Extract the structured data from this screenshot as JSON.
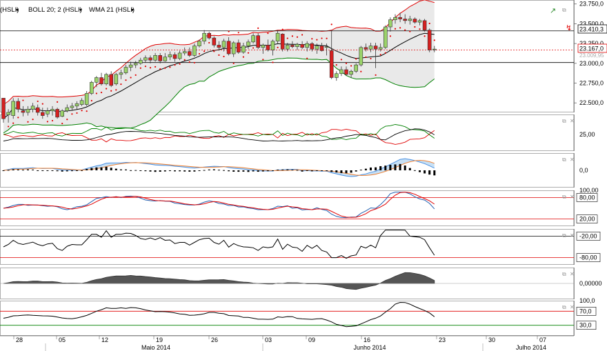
{
  "toolbar": {
    "items": [
      {
        "label": "(HSLI)",
        "menu": true
      },
      {
        "label": "BOLL 20; 2 (HSLI)",
        "menu": true
      },
      {
        "label": "WMA 21 (HSLI)",
        "menu": true
      }
    ]
  },
  "price_badges": {
    "current": "23.410,3",
    "last": "23.167,0",
    "other": "23.009,95"
  },
  "panel_icons": [
    "maximize-icon",
    "close-icon"
  ],
  "chart_data": [
    {
      "type": "candlestick",
      "panel": "price",
      "y_ticks": [
        {
          "value": 23750,
          "label": "23.750,0"
        },
        {
          "value": 23500,
          "label": "23.500,0"
        },
        {
          "value": 23250,
          "label": "23.250,0"
        },
        {
          "value": 23000,
          "label": "23.000,0"
        },
        {
          "value": 22750,
          "label": "22.750,0"
        },
        {
          "value": 22500,
          "label": "22.500,0"
        }
      ],
      "ylim": [
        22380,
        23800
      ],
      "hlines": [
        {
          "value": 23410,
          "color": "#000000"
        },
        {
          "value": 23167,
          "color": "#e00000"
        },
        {
          "value": 23010,
          "color": "#000000"
        }
      ],
      "overlays": [
        "bollinger-upper",
        "bollinger-lower",
        "wma-21",
        "parabolic-sar"
      ],
      "candles": [
        [
          22560,
          22560,
          22250,
          22300
        ],
        [
          22350,
          22420,
          22250,
          22380
        ],
        [
          22340,
          22560,
          22300,
          22520
        ],
        [
          22520,
          22560,
          22380,
          22420
        ],
        [
          22400,
          22460,
          22330,
          22380
        ],
        [
          22380,
          22460,
          22340,
          22420
        ],
        [
          22420,
          22500,
          22380,
          22460
        ],
        [
          22440,
          22480,
          22340,
          22380
        ],
        [
          22380,
          22440,
          22300,
          22340
        ],
        [
          22360,
          22440,
          22320,
          22400
        ],
        [
          22400,
          22460,
          22340,
          22420
        ],
        [
          22420,
          22440,
          22300,
          22320
        ],
        [
          22330,
          22420,
          22320,
          22400
        ],
        [
          22400,
          22480,
          22380,
          22440
        ],
        [
          22440,
          22500,
          22400,
          22460
        ],
        [
          22460,
          22520,
          22420,
          22490
        ],
        [
          22480,
          22560,
          22460,
          22530
        ],
        [
          22480,
          22650,
          22460,
          22620
        ],
        [
          22620,
          22780,
          22600,
          22760
        ],
        [
          22760,
          22840,
          22700,
          22820
        ],
        [
          22820,
          22880,
          22720,
          22740
        ],
        [
          22740,
          22880,
          22720,
          22860
        ],
        [
          22860,
          22900,
          22700,
          22720
        ],
        [
          22740,
          22880,
          22720,
          22860
        ],
        [
          22860,
          22920,
          22800,
          22880
        ],
        [
          22880,
          22980,
          22860,
          22950
        ],
        [
          22950,
          23020,
          22900,
          22980
        ],
        [
          22980,
          23030,
          22940,
          23000
        ],
        [
          23000,
          23070,
          22980,
          23040
        ],
        [
          23040,
          23100,
          23010,
          23070
        ],
        [
          23070,
          23100,
          23000,
          23040
        ],
        [
          23040,
          23130,
          23020,
          23100
        ],
        [
          23100,
          23130,
          23000,
          23030
        ],
        [
          23030,
          23130,
          23020,
          23080
        ],
        [
          23080,
          23150,
          23040,
          23110
        ],
        [
          23110,
          23140,
          23020,
          23060
        ],
        [
          23060,
          23160,
          23040,
          23130
        ],
        [
          23130,
          23200,
          23100,
          23150
        ],
        [
          23150,
          23200,
          23080,
          23100
        ],
        [
          23100,
          23250,
          23080,
          23220
        ],
        [
          23220,
          23300,
          23200,
          23280
        ],
        [
          23280,
          23420,
          23240,
          23380
        ],
        [
          23380,
          23400,
          23300,
          23320
        ],
        [
          23320,
          23340,
          23200,
          23230
        ],
        [
          23230,
          23280,
          23160,
          23200
        ],
        [
          23200,
          23310,
          23150,
          23280
        ],
        [
          23280,
          23330,
          23100,
          23120
        ],
        [
          23120,
          23280,
          23080,
          23260
        ],
        [
          23260,
          23300,
          23120,
          23140
        ],
        [
          23140,
          23260,
          23120,
          23220
        ],
        [
          23220,
          23300,
          23180,
          23270
        ],
        [
          23270,
          23380,
          23250,
          23350
        ],
        [
          23350,
          23380,
          23180,
          23200
        ],
        [
          23200,
          23250,
          23120,
          23230
        ],
        [
          23230,
          23300,
          23150,
          23170
        ],
        [
          23170,
          23300,
          23100,
          23280
        ],
        [
          23280,
          23420,
          23240,
          23380
        ],
        [
          23370,
          23380,
          23150,
          23180
        ],
        [
          23180,
          23260,
          23150,
          23230
        ],
        [
          23230,
          23280,
          23190,
          23210
        ],
        [
          23210,
          23260,
          23170,
          23240
        ],
        [
          23240,
          23280,
          23180,
          23200
        ],
        [
          23200,
          23280,
          23150,
          23250
        ],
        [
          23250,
          23270,
          23150,
          23180
        ],
        [
          23180,
          23250,
          23120,
          23220
        ],
        [
          23220,
          23260,
          23150,
          23160
        ],
        [
          23200,
          23250,
          23100,
          23210
        ],
        [
          23160,
          23420,
          22800,
          22820
        ],
        [
          22820,
          22900,
          22780,
          22870
        ],
        [
          22870,
          22960,
          22840,
          22920
        ],
        [
          22920,
          22960,
          22840,
          22860
        ],
        [
          22860,
          22920,
          22820,
          22900
        ],
        [
          22900,
          23000,
          22880,
          22980
        ],
        [
          22980,
          23220,
          22960,
          23200
        ],
        [
          23200,
          23250,
          23150,
          23180
        ],
        [
          23180,
          23260,
          23140,
          23220
        ],
        [
          23220,
          23260,
          22940,
          23180
        ],
        [
          23180,
          23250,
          23150,
          23200
        ],
        [
          23200,
          23480,
          23180,
          23460
        ],
        [
          23460,
          23580,
          23400,
          23550
        ],
        [
          23550,
          23620,
          23500,
          23580
        ],
        [
          23580,
          23640,
          23520,
          23560
        ],
        [
          23560,
          23620,
          23500,
          23540
        ],
        [
          23540,
          23600,
          23490,
          23560
        ],
        [
          23560,
          23580,
          23500,
          23520
        ],
        [
          23520,
          23560,
          23480,
          23540
        ],
        [
          23540,
          23560,
          23400,
          23420
        ],
        [
          23420,
          23440,
          23140,
          23170
        ],
        [
          23170,
          23220,
          23140,
          23180
        ]
      ]
    },
    {
      "type": "line",
      "panel": "dmi",
      "y_ticks": [
        {
          "value": 25,
          "label": "25,00"
        }
      ],
      "series": [
        {
          "color": "#e00000"
        },
        {
          "color": "#008000"
        },
        {
          "color": "#000000"
        }
      ]
    },
    {
      "type": "line",
      "panel": "macd",
      "y_ticks": [
        {
          "value": 0,
          "label": "0,0"
        }
      ],
      "series": [
        {
          "color": "#4a90e2"
        },
        {
          "color": "#f08030"
        },
        {
          "color": "#000000",
          "style": "histogram"
        }
      ]
    },
    {
      "type": "line",
      "panel": "stochastic",
      "y_ticks": [
        {
          "value": 100,
          "label": "100,00"
        },
        {
          "value": 80,
          "label": "80,00"
        },
        {
          "value": 20,
          "label": "20,00"
        }
      ],
      "hlines": [
        80,
        20
      ],
      "series": [
        {
          "color": "#1f5fb0"
        },
        {
          "color": "#e00000"
        }
      ]
    },
    {
      "type": "line",
      "panel": "williams-r",
      "y_ticks": [
        {
          "value": -20,
          "label": "-20,00"
        },
        {
          "value": -80,
          "label": "-80,00"
        }
      ],
      "hlines": [
        -20,
        -80
      ],
      "series": [
        {
          "color": "#000000"
        }
      ]
    },
    {
      "type": "area",
      "panel": "momentum-oscillator",
      "y_ticks": [
        {
          "value": 0,
          "label": "0,00000"
        }
      ],
      "series": [
        {
          "color": "#555555"
        }
      ]
    },
    {
      "type": "line",
      "panel": "rsi",
      "y_ticks": [
        {
          "value": 100,
          "label": "100,0"
        },
        {
          "value": 70,
          "label": "70,0"
        },
        {
          "value": 30,
          "label": "30,0"
        }
      ],
      "hlines": [
        70,
        30
      ],
      "series": [
        {
          "color": "#000000"
        }
      ]
    }
  ],
  "x_axis": {
    "days": [
      "28",
      "05",
      "12",
      "19",
      "26",
      "03",
      "09",
      "16",
      "23",
      "30",
      "07"
    ],
    "months": [
      "Maio 2014",
      "Junho 2014",
      "Julho 2014"
    ]
  }
}
